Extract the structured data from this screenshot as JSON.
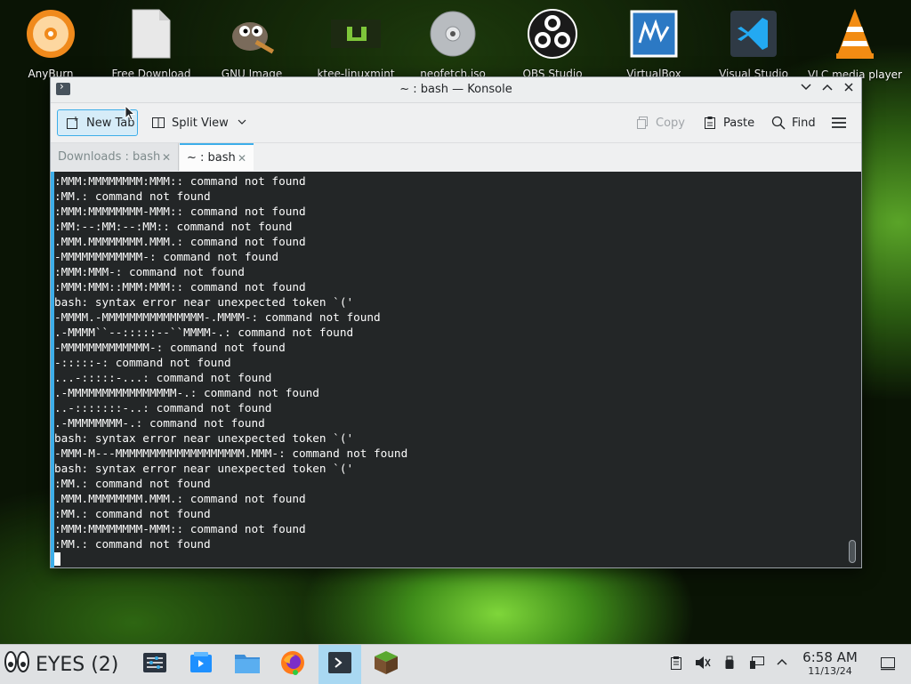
{
  "desktop": {
    "icons": [
      {
        "label": "AnyBurn",
        "icon": "anyburn-disc-icon"
      },
      {
        "label": "Free Download",
        "icon": "blank-file-icon"
      },
      {
        "label": "GNU Image",
        "icon": "gimp-icon"
      },
      {
        "label": "ktee-linuxmint",
        "icon": "linux-mint-icon"
      },
      {
        "label": "neofetch.iso",
        "icon": "disc-image-icon"
      },
      {
        "label": "OBS Studio",
        "icon": "obs-icon"
      },
      {
        "label": "VirtualBox",
        "icon": "virtualbox-icon"
      },
      {
        "label": "Visual Studio",
        "icon": "vscode-icon"
      },
      {
        "label": "VLC media player",
        "icon": "vlc-icon"
      }
    ]
  },
  "window": {
    "title": "~ : bash — Konsole",
    "toolbar": {
      "new_tab": "New Tab",
      "split_view": "Split View",
      "copy": "Copy",
      "paste": "Paste",
      "find": "Find"
    },
    "tabs": [
      {
        "label": "Downloads : bash",
        "active": false
      },
      {
        "label": "~ : bash",
        "active": true
      }
    ],
    "terminal_lines": [
      ":MMM:MMMMMMMM:MMM:: command not found",
      ":MM.: command not found",
      ":MMM:MMMMMMMM-MMM:: command not found",
      ":MM:--:MM:--:MM:: command not found",
      ".MMM.MMMMMMMM.MMM.: command not found",
      "-MMMMMMMMMMMM-: command not found",
      ":MMM:MMM-: command not found",
      ":MMM:MMM::MMM:MMM:: command not found",
      "bash: syntax error near unexpected token `('",
      "-MMMM.-MMMMMMMMMMMMMMM-.MMMM-: command not found",
      ".-MMMM``--:::::--``MMMM-.: command not found",
      "-MMMMMMMMMMMMM-: command not found",
      "-:::::-: command not found",
      "...-:::::-...: command not found",
      ".-MMMMMMMMMMMMMMMM-.: command not found",
      "..-:::::::-..: command not found",
      ".-MMMMMMMM-.: command not found",
      "bash: syntax error near unexpected token `('",
      "-MMM-M---MMMMMMMMMMMMMMMMMMM.MMM-: command not found",
      "bash: syntax error near unexpected token `('",
      ":MM.: command not found",
      ".MMM.MMMMMMMM.MMM.: command not found",
      ":MM.: command not found",
      ":MMM:MMMMMMMM-MMM:: command not found",
      ":MM.: command not found"
    ]
  },
  "taskbar": {
    "activities_label": "EYES (2)",
    "apps": [
      "system-settings-icon",
      "discover-store-icon",
      "file-manager-icon",
      "firefox-icon",
      "konsole-icon",
      "minecraft-icon"
    ],
    "clock_time": "6:58 AM",
    "clock_date": "11/13/24"
  },
  "colors": {
    "accent": "#3daee9",
    "terminal_bg": "#232627",
    "terminal_fg": "#fcfcfc"
  }
}
